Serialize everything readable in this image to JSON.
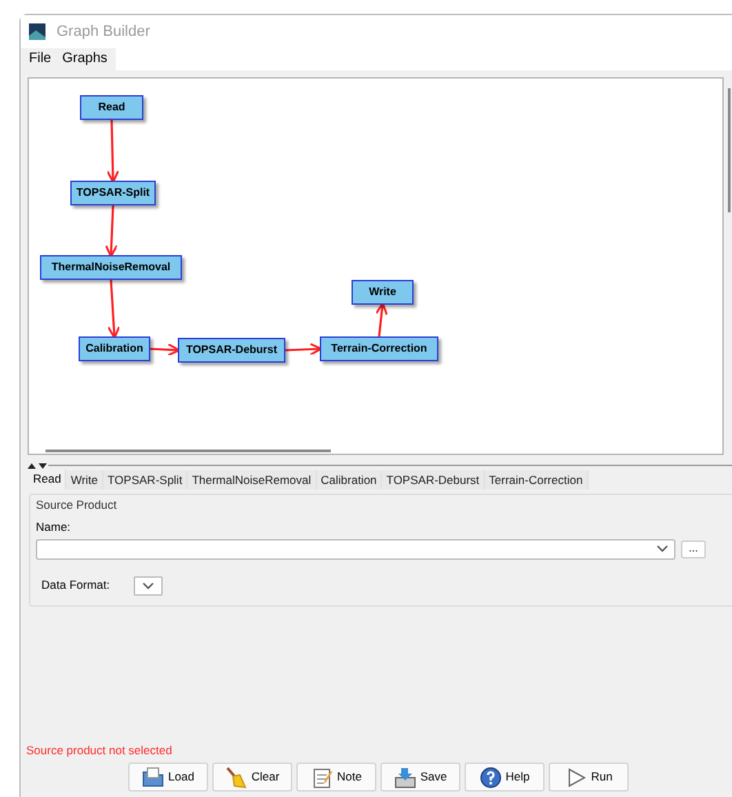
{
  "window": {
    "title": "Graph Builder"
  },
  "menu": [
    "File",
    "Graphs"
  ],
  "graph": {
    "nodes": [
      {
        "label": "Read"
      },
      {
        "label": "TOPSAR-Split"
      },
      {
        "label": "ThermalNoiseRemoval"
      },
      {
        "label": "Write"
      },
      {
        "label": "Calibration"
      },
      {
        "label": "TOPSAR-Deburst"
      },
      {
        "label": "Terrain-Correction"
      }
    ]
  },
  "tabs": [
    {
      "label": "Read",
      "selected": true
    },
    {
      "label": "Write",
      "selected": false
    },
    {
      "label": "TOPSAR-Split",
      "selected": false
    },
    {
      "label": "ThermalNoiseRemoval",
      "selected": false
    },
    {
      "label": "Calibration",
      "selected": false
    },
    {
      "label": "TOPSAR-Deburst",
      "selected": false
    },
    {
      "label": "Terrain-Correction",
      "selected": false
    }
  ],
  "source_product": {
    "title": "Source Product",
    "name_label": "Name:",
    "browse": "...",
    "format_label": "Data Format:"
  },
  "status": "Source product not selected",
  "buttons": [
    {
      "kind": "load",
      "label": "Load"
    },
    {
      "kind": "clear",
      "label": "Clear"
    },
    {
      "kind": "note",
      "label": "Note"
    },
    {
      "kind": "save",
      "label": "Save"
    },
    {
      "kind": "help",
      "label": "Help"
    },
    {
      "kind": "run",
      "label": "Run"
    }
  ]
}
